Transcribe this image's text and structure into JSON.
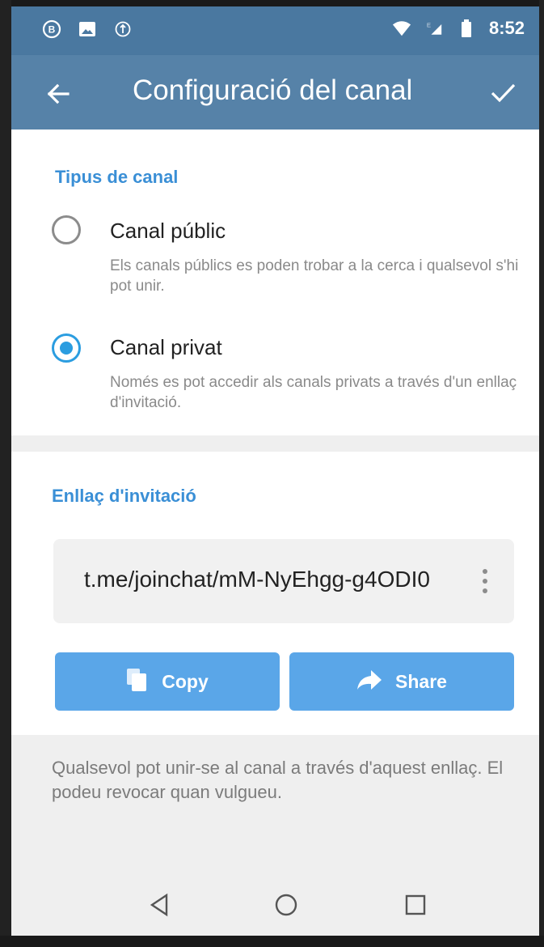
{
  "status_bar": {
    "time": "8:52",
    "left_icons": [
      "b-circle-icon",
      "image-icon",
      "data-saver-icon"
    ],
    "right_icons": [
      "wifi-icon",
      "signal-e-icon",
      "battery-icon"
    ]
  },
  "app_bar": {
    "title": "Configuració del canal",
    "back_icon": "arrow-back-icon",
    "confirm_icon": "check-icon"
  },
  "channel_type": {
    "header": "Tipus de canal",
    "options": [
      {
        "title": "Canal públic",
        "description": "Els canals públics es poden trobar a la cerca i qualsevol s'hi pot unir.",
        "selected": false
      },
      {
        "title": "Canal privat",
        "description": "Només es pot accedir als canals privats a través d'un enllaç d'invitació.",
        "selected": true
      }
    ]
  },
  "invite_link": {
    "header": "Enllaç d'invitació",
    "link": "t.me/joinchat/mM-NyEhgg-g4ODI0",
    "copy_label": "Copy",
    "share_label": "Share",
    "info": "Qualsevol pot unir-se al canal a través d'aquest enllaç. El podeu revocar quan vulgueu."
  },
  "colors": {
    "status_bar": "#4a78a0",
    "app_bar": "#5682a8",
    "accent": "#3a8fd6",
    "button": "#5aa6e8",
    "radio_on": "#2b9de0"
  }
}
